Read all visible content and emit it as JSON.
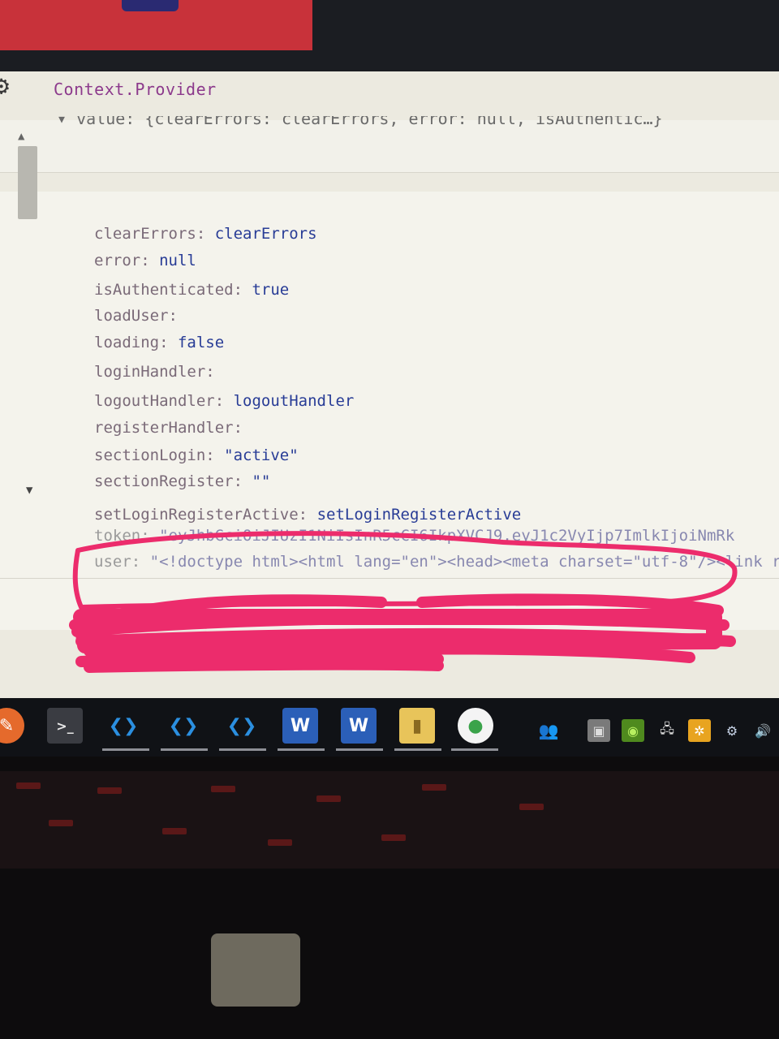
{
  "devtools": {
    "component_title": "Context.Provider",
    "value_summary": "▾ value: {clearErrors: clearErrors, error: null, isAuthentic…}",
    "props": [
      {
        "key": "clearErrors:",
        "value": "clearErrors"
      },
      {
        "key": "error:",
        "value": "null"
      },
      {
        "key": "isAuthenticated:",
        "value": "true"
      },
      {
        "key": "loadUser:",
        "value": ""
      },
      {
        "key": "loading:",
        "value": "false"
      },
      {
        "key": "loginHandler:",
        "value": ""
      },
      {
        "key": "logoutHandler:",
        "value": "logoutHandler"
      },
      {
        "key": "registerHandler:",
        "value": ""
      },
      {
        "key": "sectionLogin:",
        "value": "\"active\""
      },
      {
        "key": "sectionRegister:",
        "value": "\"\""
      },
      {
        "key": "setLoginRegisterActive:",
        "value": "setLoginRegisterActive"
      },
      {
        "key": "token:",
        "value": "\"eyJhbGciOiJIUzI1NiIsInR5cCI6IkpXVCJ9.eyJ1c2VyIjp7ImlkIjoiNmRk"
      },
      {
        "key": "user:",
        "value": "\"<!doctype html><html lang=\"en\"><head><meta charset=\"utf-8\"/><link rel=\""
      }
    ]
  },
  "taskbar": {
    "apps": [
      "postman-icon",
      "terminal-icon",
      "vscode-icon",
      "vscode-icon",
      "vscode-icon",
      "word-icon",
      "word-icon",
      "file-explorer-icon",
      "mongodb-compass-icon"
    ],
    "tray": [
      "people-icon",
      "task-view-icon",
      "nvidia-icon",
      "network-icon",
      "updates-icon",
      "steam-icon",
      "volume-icon"
    ]
  },
  "colors": {
    "annotation": "#ec2c6c",
    "key": "#7a6a78",
    "value": "#283c96",
    "component": "#8c3a8c"
  }
}
